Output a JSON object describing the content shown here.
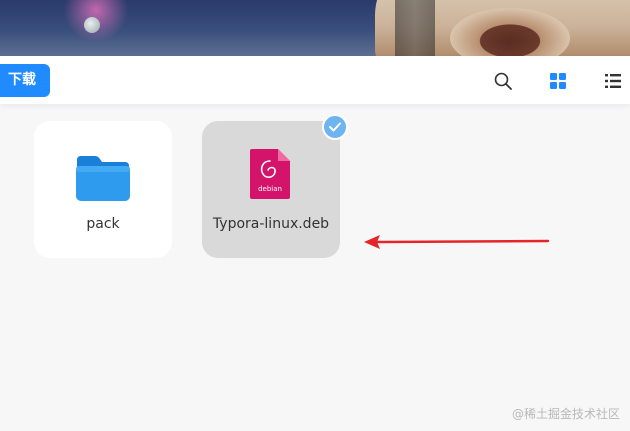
{
  "toolbar": {
    "download_label": "下载",
    "search_icon": "search-icon",
    "grid_view_icon": "grid-view-icon",
    "list_view_icon": "list-view-icon"
  },
  "files": [
    {
      "name": "pack",
      "type": "folder",
      "selected": false
    },
    {
      "name": "Typora-linux.deb",
      "type": "deb",
      "selected": true
    }
  ],
  "deb_badge": "debian",
  "watermark": "@稀土掘金技术社区",
  "colors": {
    "accent": "#1f8bff",
    "folder": "#2f9bef",
    "deb": "#d4146a",
    "arrow": "#e5252a",
    "check": "#6eb4f0"
  }
}
